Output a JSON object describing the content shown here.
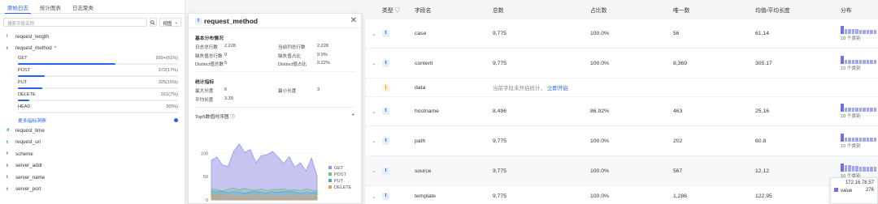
{
  "left": {
    "tabs": [
      "原始日志",
      "统计图表",
      "日志聚类"
    ],
    "search_placeholder": "搜索字段名称",
    "view_select": "视图",
    "fields_top": [
      {
        "type": "l",
        "name": "request_length"
      }
    ],
    "expanded_field": {
      "type": "t",
      "name": "request_method",
      "chevron": "^"
    },
    "values": [
      {
        "label": "GET",
        "count": "999+(61%)",
        "pct": 61
      },
      {
        "label": "POST",
        "count": "372(17%)",
        "pct": 17
      },
      {
        "label": "PUT",
        "count": "325(15%)",
        "pct": 15
      },
      {
        "label": "DELETE",
        "count": "161(7%)",
        "pct": 7
      },
      {
        "label": "HEAD",
        "count": "3(0%)",
        "pct": 0
      }
    ],
    "more_link": "更多指标洞察",
    "fields_bottom": [
      {
        "type": "d",
        "name": "request_time"
      },
      {
        "type": "t",
        "name": "request_uri"
      },
      {
        "type": "t",
        "name": "scheme"
      },
      {
        "type": "t",
        "name": "server_addr"
      },
      {
        "type": "t",
        "name": "server_name"
      },
      {
        "type": "t",
        "name": "server_port"
      }
    ]
  },
  "popup": {
    "badge": "t",
    "title": "request_method",
    "basic_section": "基本分布情况",
    "basic_stats": [
      [
        "日志总行数",
        "2,228",
        "当前列总行数",
        "2,228"
      ],
      [
        "缺失值总行数",
        "0",
        "缺失值占比",
        "0.0%"
      ],
      [
        "Distinct值总数",
        "5",
        "Distinct值占比",
        "0.22%"
      ]
    ],
    "metric_section": "统计指标",
    "metric_stats": [
      [
        "最大长度",
        "6",
        "最小长度",
        "3"
      ],
      [
        "平均长度",
        "3.39",
        "",
        ""
      ]
    ],
    "chart_title": "Top5数值时序图",
    "chart_add": "+"
  },
  "chart_data": {
    "type": "area",
    "yticks": [
      0,
      50,
      100
    ],
    "ylim": [
      0,
      125
    ],
    "series": [
      {
        "name": "GET",
        "color": "#9b93e8",
        "values": [
          85,
          92,
          75,
          72,
          104,
          120,
          102,
          108,
          80,
          95,
          97,
          104,
          92,
          78,
          93,
          70,
          80,
          62,
          90,
          52
        ]
      },
      {
        "name": "POST",
        "color": "#6fbf8f",
        "values": [
          24,
          22,
          19,
          23,
          26,
          21,
          25,
          22,
          21,
          24,
          20,
          23,
          22,
          24,
          21,
          22,
          20,
          24,
          21,
          19
        ]
      },
      {
        "name": "PUT",
        "color": "#4fa8d8",
        "values": [
          20,
          17,
          18,
          15,
          18,
          16,
          14,
          17,
          18,
          16,
          15,
          18,
          16,
          18,
          19,
          17,
          14,
          16,
          15,
          16
        ]
      },
      {
        "name": "DELETE",
        "color": "#e79c5a",
        "values": [
          9,
          12,
          10,
          11,
          8,
          7,
          10,
          9,
          11,
          8,
          9,
          10,
          7,
          9,
          8,
          11,
          9,
          10,
          8,
          9
        ]
      }
    ]
  },
  "table": {
    "headers": {
      "type": "类型",
      "name": "字段名",
      "total": "总数",
      "pct": "占比数",
      "uniq": "唯一数",
      "avg": "均值/平均长度",
      "dist": "分布"
    },
    "rows": [
      {
        "type": "t",
        "name": "case",
        "total": "9,775",
        "pct": "100.0%",
        "uniq": "56",
        "avg": "61.14",
        "dist": "10 个类别",
        "bars": [
          10,
          6,
          6,
          6,
          6,
          5,
          5,
          5,
          5,
          5
        ]
      },
      {
        "type": "t",
        "name": "content",
        "total": "9,775",
        "pct": "100.0%",
        "uniq": "8,369",
        "avg": "305.17",
        "dist": "10 个类别",
        "bars": [
          10,
          5,
          5,
          5,
          5,
          5,
          5,
          5,
          5,
          5
        ]
      },
      {
        "type": "j",
        "name": "data",
        "note": "当前字段未开启统计，",
        "note_link": "立即开启"
      },
      {
        "type": "t",
        "name": "hostname",
        "total": "8,496",
        "pct": "86.92%",
        "uniq": "463",
        "avg": "25.16",
        "dist": "10 个类别",
        "bars": [
          10,
          5,
          5,
          5,
          5,
          5,
          5,
          5,
          5,
          5
        ]
      },
      {
        "type": "t",
        "name": "path",
        "total": "9,775",
        "pct": "100.0%",
        "uniq": "202",
        "avg": "60.8",
        "dist": "10 个类别",
        "bars": [
          10,
          5,
          5,
          5,
          5,
          5,
          5,
          5,
          5,
          5
        ]
      },
      {
        "type": "t",
        "name": "source",
        "total": "9,775",
        "pct": "100.0%",
        "uniq": "567",
        "avg": "12.12",
        "dist": "10 个类别",
        "bars": [
          10,
          8,
          8,
          7,
          7,
          6,
          6,
          6,
          6,
          6
        ]
      },
      {
        "type": "t",
        "name": "template",
        "total": "9,775",
        "pct": "100.0%",
        "uniq": "1,286",
        "avg": "122.95",
        "dist": "-"
      }
    ],
    "tooltip": {
      "title": "172.16.78.57",
      "label": "value",
      "value": "276"
    }
  }
}
